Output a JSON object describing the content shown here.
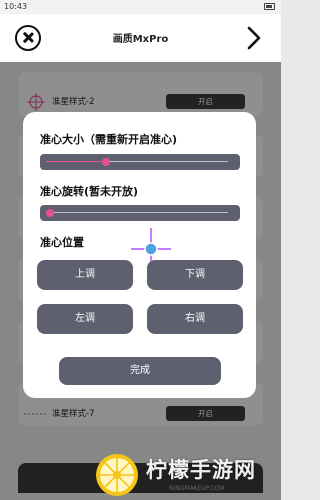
{
  "status_bar": {
    "time": "10:43"
  },
  "header": {
    "title": "画质MxPro",
    "close_icon": "close-circle-icon",
    "next_icon": "chevron-right-icon"
  },
  "rows": [
    {
      "label": "准星样式-2",
      "toggle": "开启",
      "icon": "crosshair-circle-icon"
    },
    {
      "label": "准星样式-7",
      "toggle": "开启",
      "icon": "dashed-line-icon"
    }
  ],
  "dialog": {
    "size_label": "准心大小（需重新开启准心)",
    "size_value": 0.33,
    "rotate_label": "准心旋转(暂未开放)",
    "rotate_value": 0.02,
    "position_label": "准心位置",
    "buttons": {
      "up": "上调",
      "down": "下调",
      "left": "左调",
      "right": "右调"
    },
    "done": "完成"
  },
  "colors": {
    "accent": "#e64e95",
    "crosshair": "#c77dff",
    "crosshair_center": "#4ea3e6",
    "button": "#5e6070",
    "toggle": "#3b3b3b"
  },
  "watermark": {
    "brand": "柠檬手游网",
    "url": "NINGMAKEUP.COM",
    "logo": "lemon-logo-icon"
  }
}
